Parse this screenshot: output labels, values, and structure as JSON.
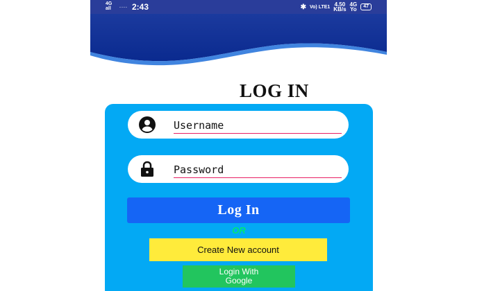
{
  "status_bar": {
    "network_left_top": "4G",
    "network_left_bottom": "all",
    "signal_dots": "....",
    "time": "2:43",
    "bluetooth_icon": "bluetooth-icon",
    "volte": "Vo) LTE1",
    "speed_value": "4.50",
    "speed_unit": "KB/s",
    "network_right_top": "4G",
    "network_right_bottom": "Yo",
    "battery": "47"
  },
  "header": {
    "wave_color": "#0b2f9f",
    "accent_line_color": "#1e6fd9"
  },
  "title": "LOG IN",
  "form": {
    "username": {
      "icon": "user-icon",
      "value": "Username"
    },
    "password": {
      "icon": "lock-icon",
      "value": "Password"
    }
  },
  "buttons": {
    "login": "Log In",
    "or": "OR",
    "create_account": "Create New account",
    "google_line1": "Login With",
    "google_line2": "Google"
  },
  "colors": {
    "card": "#03a9f4",
    "login_button": "#1565f5",
    "create_button": "#ffeb3b",
    "google_button": "#22c55e",
    "or_text": "#00e676",
    "input_underline": "#e91e63"
  }
}
